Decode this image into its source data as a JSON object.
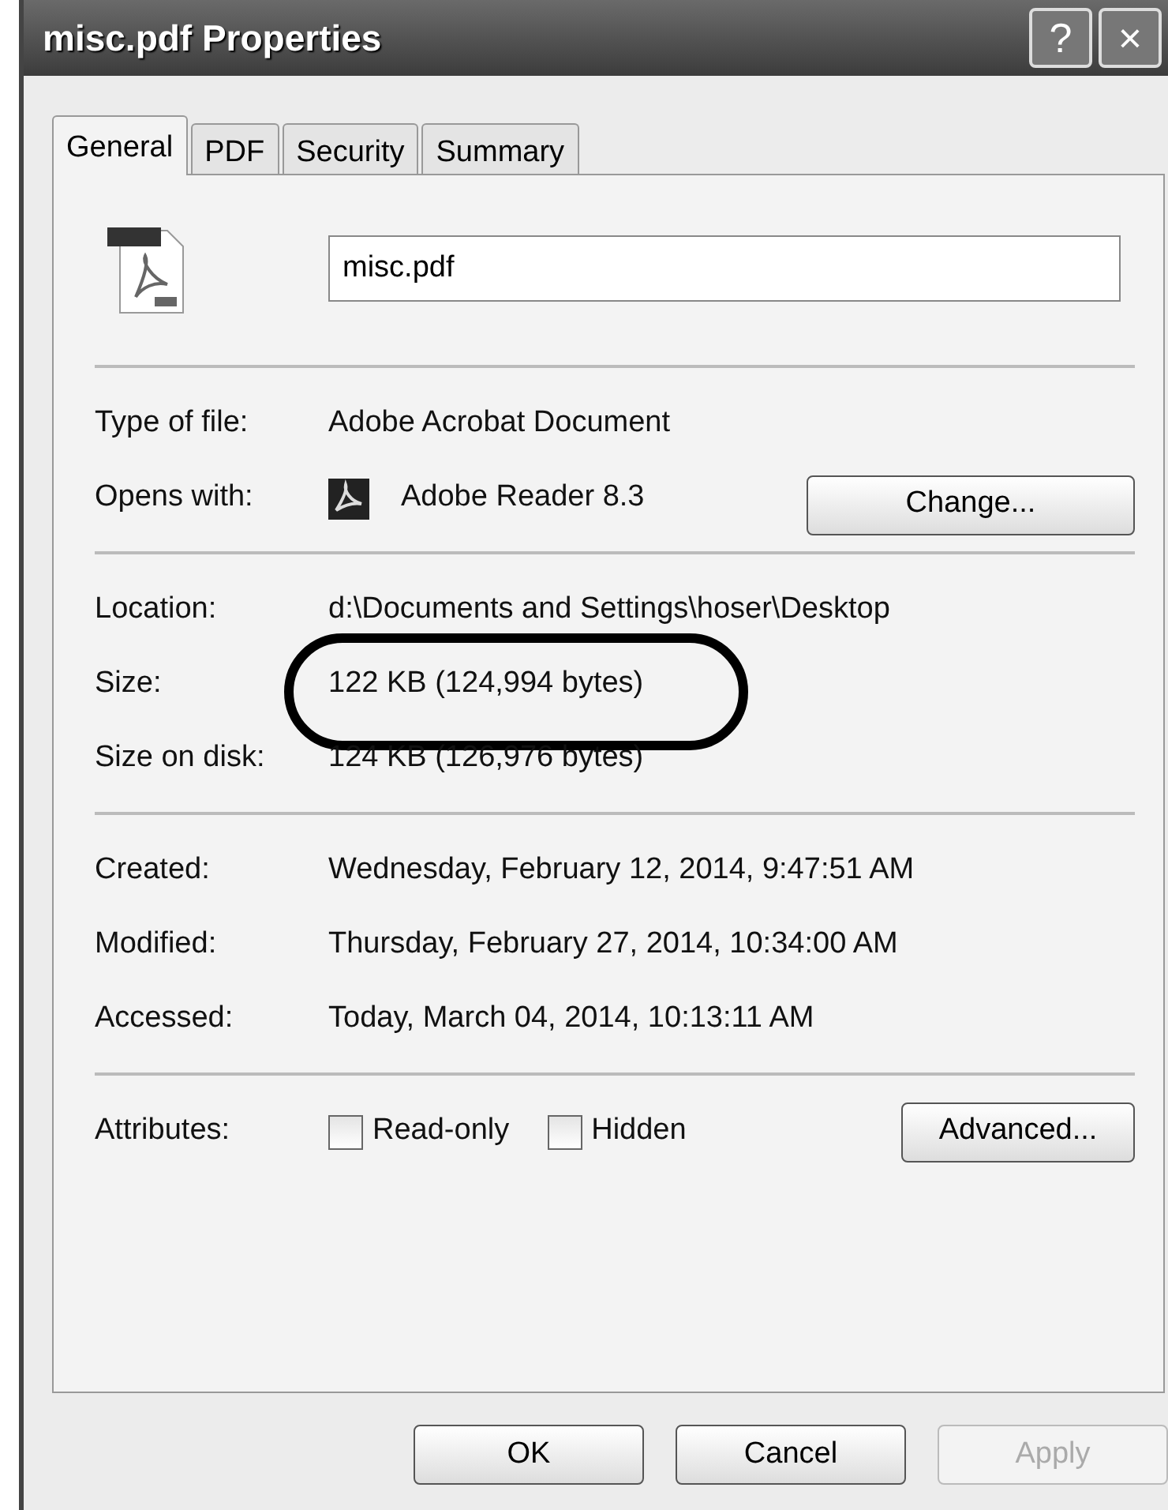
{
  "window": {
    "title": "misc.pdf Properties",
    "title_buttons": [
      "?",
      "×"
    ]
  },
  "tabs": [
    {
      "label": "General",
      "selected": true
    },
    {
      "label": "PDF",
      "selected": false
    },
    {
      "label": "Security",
      "selected": false
    },
    {
      "label": "Summary",
      "selected": false
    }
  ],
  "file_name": {
    "value": "misc.pdf"
  },
  "sections": [
    [
      {
        "label": "Type of file:",
        "value": "Adobe Acrobat Document"
      },
      {
        "label": "Opens with:",
        "value": "Adobe Reader 8.3",
        "kind": "app",
        "button": "Change..."
      }
    ],
    [
      {
        "label": "Location:",
        "value": "d:\\Documents and Settings\\hoser\\Desktop"
      },
      {
        "label": "Size:",
        "value": "122 KB (124,994 bytes)",
        "circled": true
      },
      {
        "label": "Size on disk:",
        "value": "124 KB (126,976 bytes)",
        "circled": false
      }
    ],
    [
      {
        "label": "Created:",
        "value": "Wednesday, February 12, 2014, 9:47:51 AM"
      },
      {
        "label": "Modified:",
        "value": "Thursday, February 27, 2014, 10:34:00 AM"
      },
      {
        "label": "Accessed:",
        "value": "Today, March 04, 2014, 10:13:11 AM"
      }
    ]
  ],
  "attributes": {
    "label": "Attributes:",
    "checkboxes": [
      {
        "label": "Read-only",
        "checked": false
      },
      {
        "label": "Hidden",
        "checked": false
      }
    ],
    "button": "Advanced..."
  },
  "buttons": [
    {
      "label": "OK",
      "disabled": false
    },
    {
      "label": "Cancel",
      "disabled": false
    },
    {
      "label": "Apply",
      "disabled": true
    }
  ]
}
